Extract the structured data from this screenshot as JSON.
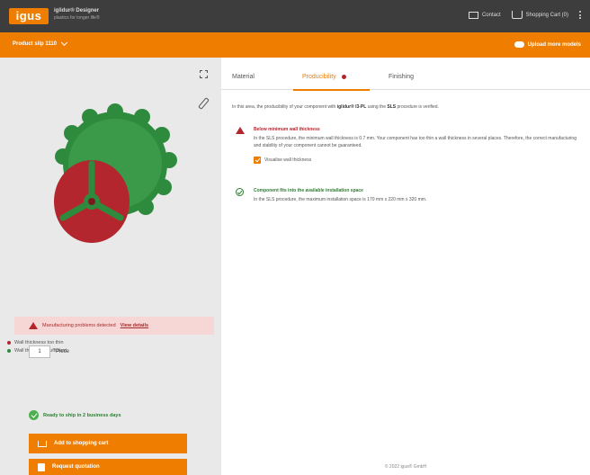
{
  "header": {
    "logo_text": "igus",
    "brand_title": "iglidur® Designer",
    "brand_subtitle": "plastics for longer life®",
    "contact_label": "Contact",
    "cart_label": "Shopping Cart (0)"
  },
  "toolbar": {
    "product_selector": "Product slip 1110",
    "upload_label": "Upload more models"
  },
  "viewer": {
    "legend": [
      {
        "label": "Wall thickness too thin",
        "color": "#b3262e"
      },
      {
        "label": "Wall thickness sufficient",
        "color": "#2e8b3e"
      }
    ],
    "warning_text": "Manufacturing problems detected",
    "warning_link": "View details"
  },
  "order": {
    "quantity": "1",
    "unit_label": "Piece",
    "shipping_text": "Ready to ship in 2 business days",
    "add_to_cart_label": "Add to shopping cart",
    "request_quote_label": "Request quotation"
  },
  "tabs": [
    {
      "label": "Material"
    },
    {
      "label": "Producibility"
    },
    {
      "label": "Finishing"
    }
  ],
  "producibility": {
    "intro_prefix": "In this area, the producibility of your component with ",
    "intro_material": "iglidur® I3-PL",
    "intro_middle": " using the ",
    "intro_process": "SLS",
    "intro_suffix": " procedure is verified.",
    "issue1_title": "Below minimum wall thickness",
    "issue1_text": "In the SLS procedure, the minimum wall thickness is 0.7 mm. Your component has too thin a wall thickness in several places. Therefore, the correct manufacturing and stability of your component cannot be guaranteed.",
    "issue1_checkbox": "Visualise wall thickness",
    "issue2_title": "Component fits into the available installation space",
    "issue2_text": "In the SLS procedure, the maximum installation space is 170 mm x 220 mm x 320 mm."
  },
  "footer": {
    "copyright": "© 2022 igus® GmbH"
  },
  "colors": {
    "accent": "#ef7d00",
    "header_bg": "#3d3d3d",
    "error": "#b3262e",
    "success": "#2e7d32"
  }
}
